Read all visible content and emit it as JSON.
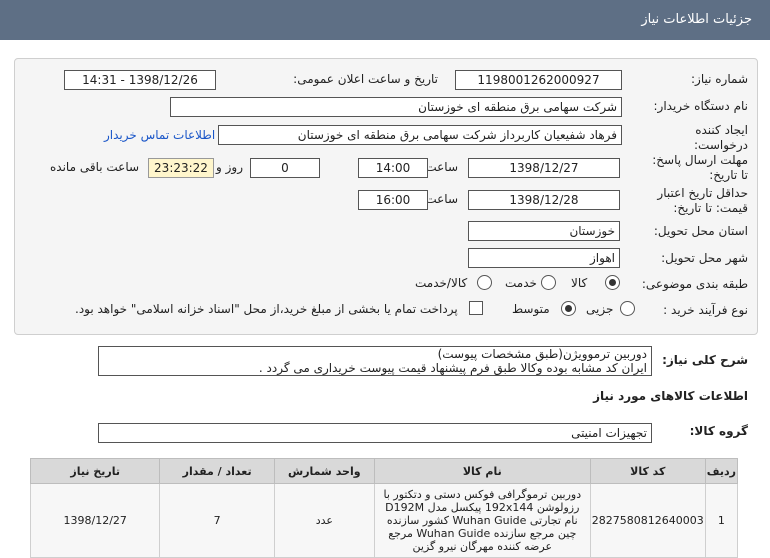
{
  "header": {
    "title": "جزئیات اطلاعات نیاز"
  },
  "form": {
    "need_number_label": "شماره نیاز:",
    "need_number": "1198001262000927",
    "announce_label": "تاریخ و ساعت اعلان عمومی:",
    "announce_value": "1398/12/26 - 14:31",
    "buyer_org_label": "نام دستگاه خریدار:",
    "buyer_org": "شرکت سهامی برق منطقه ای خوزستان",
    "creator_label": "ایجاد کننده",
    "creator_label2": "درخواست:",
    "creator": "فرهاد شفیعیان کاربرداز شرکت سهامی برق منطقه ای خوزستان",
    "contact_link": "اطلاعات تماس خریدار",
    "reply_deadline_label": "مهلت ارسال پاسخ:",
    "reply_deadline_label2": "تا تاریخ:",
    "reply_date": "1398/12/27",
    "time_label": "ساعت",
    "reply_time": "14:00",
    "days_value": "0",
    "days_label": "روز و",
    "remaining_time": "23:23:22",
    "remaining_label": "ساعت باقی مانده",
    "price_validity_label": "حداقل تاریخ اعتبار",
    "price_validity_label2": "قیمت: تا تاریخ:",
    "price_date": "1398/12/28",
    "price_time": "16:00",
    "province_label": "استان محل تحویل:",
    "province": "خوزستان",
    "city_label": "شهر محل تحویل:",
    "city": "اهواز",
    "category_label": "طبقه بندی موضوعی:",
    "category_options": [
      "کالا",
      "خدمت",
      "کالا/خدمت"
    ],
    "category_selected": 0,
    "process_label": "نوع فرآیند خرید :",
    "process_options": [
      "جزیی",
      "متوسط"
    ],
    "process_selected": 1,
    "payment_note": "پرداخت تمام یا بخشی از مبلغ خرید،از محل \"اسناد خزانه اسلامی\" خواهد بود."
  },
  "description": {
    "label": "شرح کلی نیاز:",
    "lines": [
      "دوربین ترموویژن(طبق مشخصات پیوست)",
      "ایران کد مشابه بوده وکالا طبق فرم پیشنهاد قیمت پیوست خریداری می گردد ."
    ]
  },
  "goods_info_title": "اطلاعات کالاهای مورد نیاز",
  "goods_group_label": "گروه کالا:",
  "goods_group": "تجهیزات امنیتی",
  "table": {
    "headers": [
      "ردیف",
      "کد کالا",
      "نام کالا",
      "واحد شمارش",
      "تعداد / مقدار",
      "تاریخ نیاز"
    ],
    "rows": [
      {
        "row": "1",
        "code": "2827580812640003",
        "name": "دوربین ترموگرافی فوکس دستی و دتکتور با رزولوشن 192x144 پیکسل مدل D192M نام تجارتی Wuhan Guide کشور سازنده چین مرجع سازنده Wuhan Guide مرجع عرضه کننده مهرگان نیرو گزین",
        "unit": "عدد",
        "qty": "7",
        "date": "1398/12/27"
      }
    ]
  }
}
